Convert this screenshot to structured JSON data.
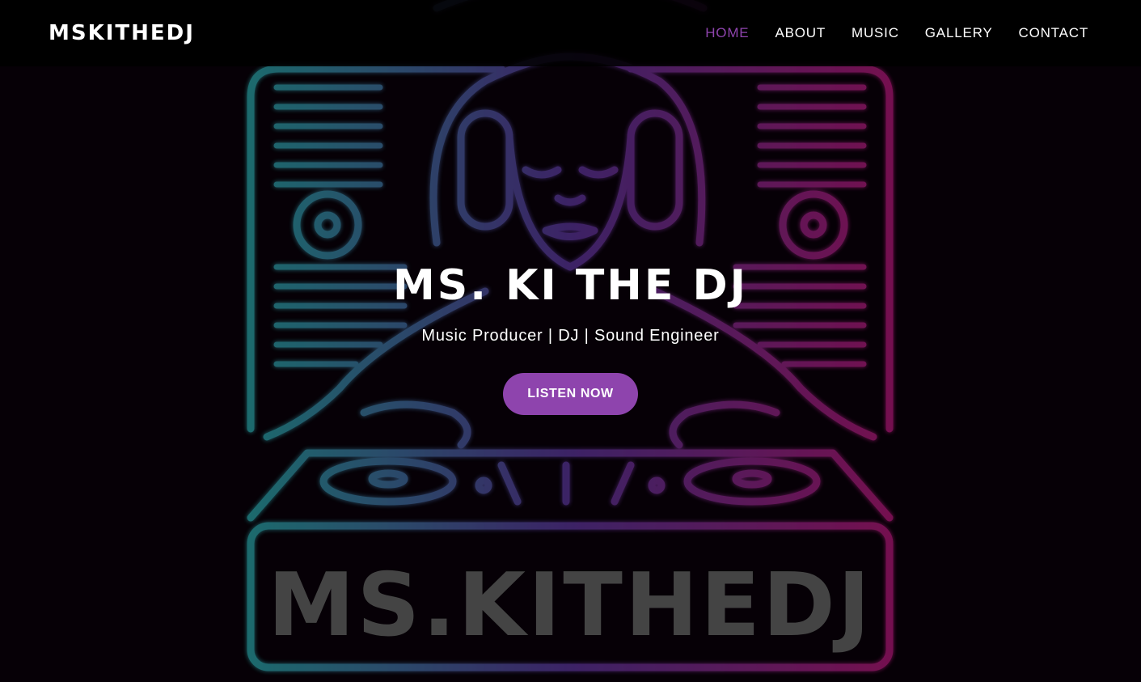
{
  "brand": {
    "name": "MSKITHEDJ"
  },
  "nav": {
    "items": [
      {
        "label": "HOME",
        "active": true
      },
      {
        "label": "ABOUT",
        "active": false
      },
      {
        "label": "MUSIC",
        "active": false
      },
      {
        "label": "GALLERY",
        "active": false
      },
      {
        "label": "CONTACT",
        "active": false
      }
    ]
  },
  "hero": {
    "title": "MS. KI THE DJ",
    "subtitle": "Music Producer | DJ | Sound Engineer",
    "cta_label": "LISTEN NOW",
    "background_logo_text": "MS.KITHEDJ"
  },
  "colors": {
    "accent": "#8e44ad",
    "neon_teal": "#2ec4c4",
    "neon_magenta": "#d21e8c",
    "navbar_bg": "#000000",
    "page_bg": "#060006"
  }
}
